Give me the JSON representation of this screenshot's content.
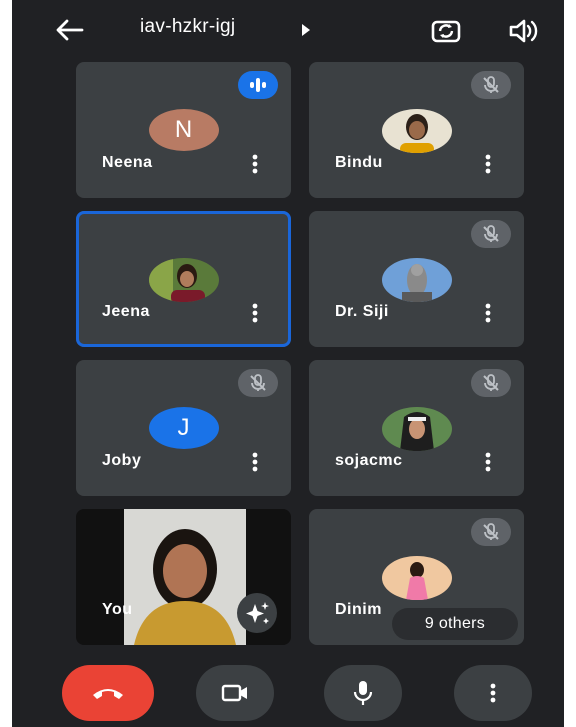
{
  "meeting": {
    "code": "iav-hzkr-igj"
  },
  "participants": [
    {
      "name": "Neena",
      "initial": "N",
      "avatar_color": "#b87b64",
      "status": "speaking"
    },
    {
      "name": "Bindu",
      "status": "muted"
    },
    {
      "name": "Jeena",
      "status": "active-speaker"
    },
    {
      "name": "Dr. Siji",
      "status": "muted"
    },
    {
      "name": "Joby",
      "initial": "J",
      "avatar_color": "#1a73e8",
      "status": "muted"
    },
    {
      "name": "sojacmc",
      "status": "muted"
    },
    {
      "name": "You",
      "status": "self-video"
    },
    {
      "name": "Dinim",
      "status": "muted"
    }
  ],
  "others": {
    "label": "9 others"
  },
  "controls": {
    "icons": [
      "end-call-icon",
      "camera-icon",
      "microphone-icon",
      "more-options-icon"
    ]
  },
  "colors": {
    "background": "#202124",
    "tile": "#3c4043",
    "active_border": "#1a66d9",
    "end_call": "#ea4335",
    "speaking_badge": "#1a73e8"
  }
}
